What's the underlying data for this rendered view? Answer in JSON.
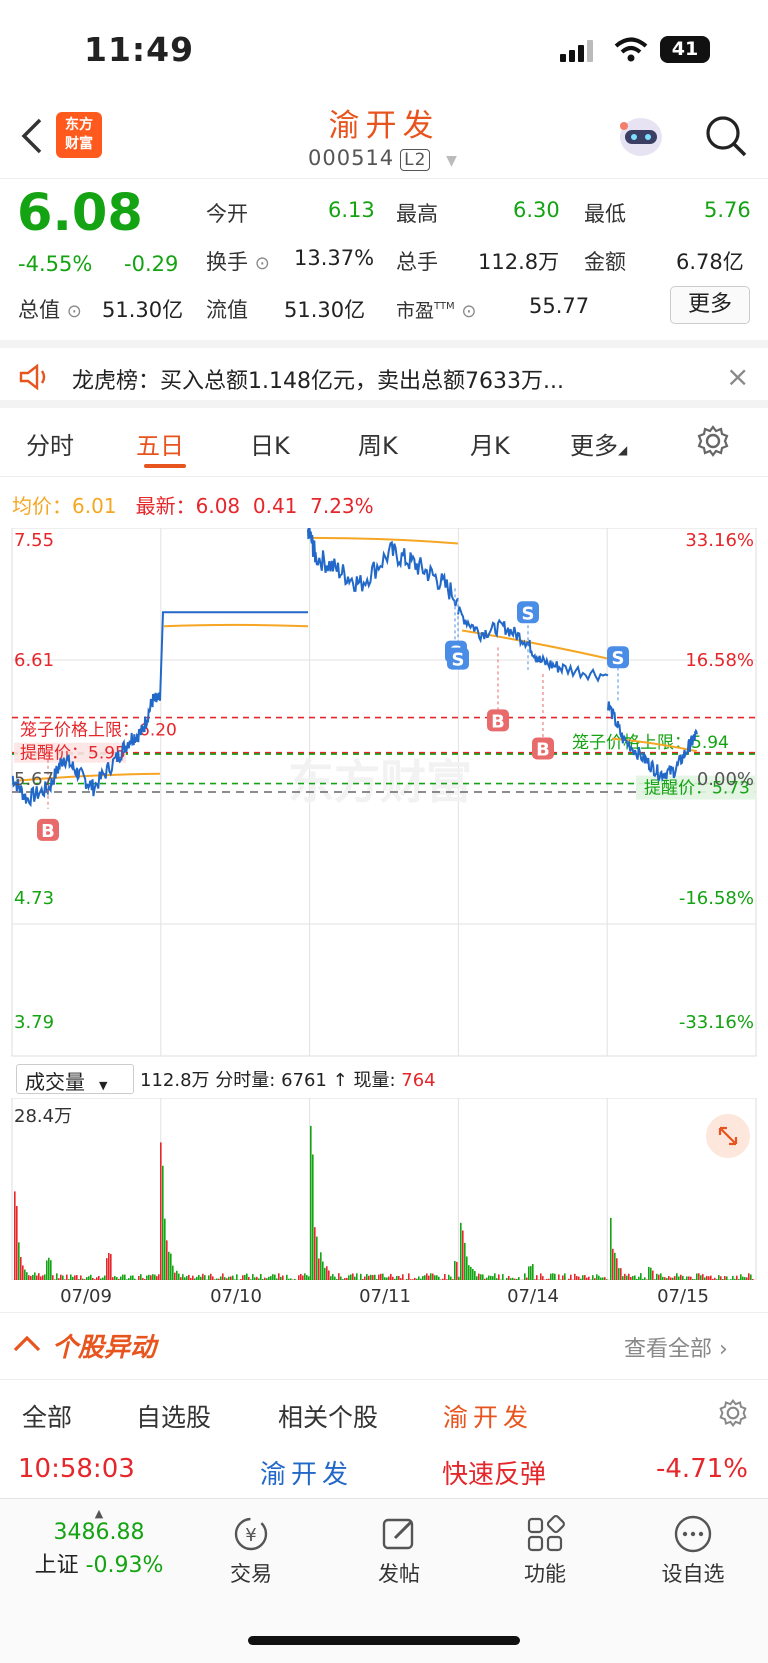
{
  "status": {
    "time": "11:49",
    "battery": "41"
  },
  "header": {
    "title": "渝开发",
    "code": "000514",
    "level": "L2",
    "logo_lines": [
      "东方",
      "财富"
    ]
  },
  "quote": {
    "price": "6.08",
    "change_pct": "-4.55%",
    "change": "-0.29",
    "open_label": "今开",
    "open": "6.13",
    "high_label": "最高",
    "high": "6.30",
    "low_label": "最低",
    "low": "5.76",
    "turnover_label": "换手",
    "turnover": "13.37%",
    "volume_label": "总手",
    "volume": "112.8万",
    "amount_label": "金额",
    "amount": "6.78亿",
    "mktcap_label": "总值",
    "mktcap": "51.30亿",
    "float_label": "流值",
    "float": "51.30亿",
    "pe_label": "市盈",
    "pe_sup": "TTM",
    "pe": "55.77",
    "more": "更多"
  },
  "notice": {
    "text": "龙虎榜：买入总额1.148亿元，卖出总额7633万..."
  },
  "tabs": [
    "分时",
    "五日",
    "日K",
    "周K",
    "月K",
    "更多"
  ],
  "legend": {
    "avg_label": "均价：",
    "avg": "6.01",
    "latest_label": "最新：",
    "latest": "6.08",
    "chg": "0.41",
    "chg_pct": "7.23%"
  },
  "chart_data": {
    "type": "line",
    "x_labels": [
      "07/09",
      "07/10",
      "07/11",
      "07/14",
      "07/15"
    ],
    "y_left_ticks": [
      "7.55",
      "6.61",
      "5.67",
      "4.73",
      "3.79"
    ],
    "y_right_ticks": [
      "33.16%",
      "16.58%",
      "0.00%",
      "-16.58%",
      "-33.16%"
    ],
    "ylim": [
      3.79,
      7.55
    ],
    "lines": {
      "cage_upper_1": {
        "label": "笼子价格上限：",
        "value": "6.20"
      },
      "remind_1": {
        "label": "提醒价：",
        "value": "5.95"
      },
      "cage_upper_2": {
        "label": "笼子价格上限：",
        "value": "5.94"
      },
      "remind_2": {
        "label": "提醒价：",
        "value": "5.73"
      }
    },
    "watermark": "东方财富"
  },
  "volume": {
    "selector": "成交量",
    "total": "112.8万",
    "tick_label": "分时量:",
    "tick": "6761",
    "arrow": "↑",
    "cur_label": "现量:",
    "cur": "764",
    "max": "28.4万"
  },
  "movers": {
    "title": "个股异动",
    "view_all": "查看全部"
  },
  "subtabs": [
    "全部",
    "自选股",
    "相关个股",
    "渝开发"
  ],
  "row": {
    "time": "10:58:03",
    "name": "渝开发",
    "event": "快速反弹",
    "pct": "-4.71%"
  },
  "bottom": {
    "index_value": "3486.88",
    "index_name": "上证",
    "index_pct": "-0.93%",
    "items": [
      "交易",
      "发帖",
      "功能",
      "设自选"
    ]
  },
  "colors": {
    "up": "#e5262b",
    "down": "#14a312",
    "accent": "#e8541e",
    "avg": "#f6a623",
    "price_line": "#2268c8"
  }
}
